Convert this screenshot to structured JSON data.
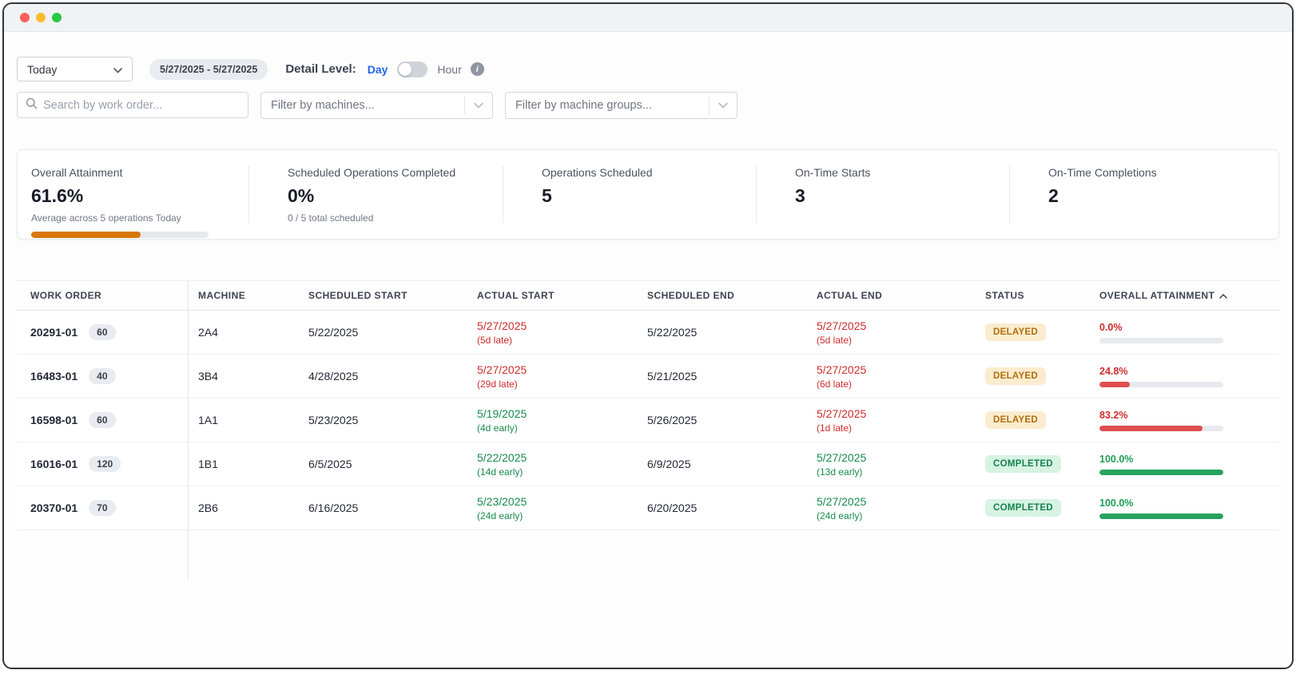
{
  "toolbar": {
    "period_select": {
      "value": "Today"
    },
    "date_range": "5/27/2025 - 5/27/2025",
    "detail_level": {
      "label": "Detail Level:",
      "day": "Day",
      "hour": "Hour",
      "info": "i"
    }
  },
  "filters": {
    "search_placeholder": "Search by work order...",
    "machines_placeholder": "Filter by machines...",
    "machine_groups_placeholder": "Filter by machine groups..."
  },
  "kpis": {
    "overall_attainment": {
      "label": "Overall Attainment",
      "value": "61.6%",
      "sub": "Average across 5 operations Today",
      "progress_pct": 61.6,
      "bar_color": "#d97706"
    },
    "scheduled_ops_completed": {
      "label": "Scheduled Operations Completed",
      "value": "0%",
      "sub": "0 / 5 total scheduled"
    },
    "operations_scheduled": {
      "label": "Operations Scheduled",
      "value": "5"
    },
    "on_time_starts": {
      "label": "On-Time Starts",
      "value": "3"
    },
    "on_time_completions": {
      "label": "On-Time Completions",
      "value": "2"
    }
  },
  "table": {
    "columns": [
      "WORK ORDER",
      "MACHINE",
      "SCHEDULED START",
      "ACTUAL START",
      "SCHEDULED END",
      "ACTUAL END",
      "STATUS",
      "OVERALL ATTAINMENT"
    ],
    "sort": {
      "column": "OVERALL ATTAINMENT",
      "direction": "ascending"
    },
    "rows": [
      {
        "work_order": "20291-01",
        "qty": "60",
        "machine": "2A4",
        "scheduled_start": "5/22/2025",
        "actual_start": {
          "date": "5/27/2025",
          "delta": "(5d late)",
          "tone": "late"
        },
        "scheduled_end": "5/22/2025",
        "actual_end": {
          "date": "5/27/2025",
          "delta": "(5d late)",
          "tone": "late"
        },
        "status": "DELAYED",
        "attainment": {
          "value": "0.0%",
          "pct": 0,
          "tone": "late"
        }
      },
      {
        "work_order": "16483-01",
        "qty": "40",
        "machine": "3B4",
        "scheduled_start": "4/28/2025",
        "actual_start": {
          "date": "5/27/2025",
          "delta": "(29d late)",
          "tone": "late"
        },
        "scheduled_end": "5/21/2025",
        "actual_end": {
          "date": "5/27/2025",
          "delta": "(6d late)",
          "tone": "late"
        },
        "status": "DELAYED",
        "attainment": {
          "value": "24.8%",
          "pct": 24.8,
          "tone": "late"
        }
      },
      {
        "work_order": "16598-01",
        "qty": "60",
        "machine": "1A1",
        "scheduled_start": "5/23/2025",
        "actual_start": {
          "date": "5/19/2025",
          "delta": "(4d early)",
          "tone": "early"
        },
        "scheduled_end": "5/26/2025",
        "actual_end": {
          "date": "5/27/2025",
          "delta": "(1d late)",
          "tone": "late"
        },
        "status": "DELAYED",
        "attainment": {
          "value": "83.2%",
          "pct": 83.2,
          "tone": "late"
        }
      },
      {
        "work_order": "16016-01",
        "qty": "120",
        "machine": "1B1",
        "scheduled_start": "6/5/2025",
        "actual_start": {
          "date": "5/22/2025",
          "delta": "(14d early)",
          "tone": "early"
        },
        "scheduled_end": "6/9/2025",
        "actual_end": {
          "date": "5/27/2025",
          "delta": "(13d early)",
          "tone": "early"
        },
        "status": "COMPLETED",
        "attainment": {
          "value": "100.0%",
          "pct": 100,
          "tone": "early"
        }
      },
      {
        "work_order": "20370-01",
        "qty": "70",
        "machine": "2B6",
        "scheduled_start": "6/16/2025",
        "actual_start": {
          "date": "5/23/2025",
          "delta": "(24d early)",
          "tone": "early"
        },
        "scheduled_end": "6/20/2025",
        "actual_end": {
          "date": "5/27/2025",
          "delta": "(24d early)",
          "tone": "early"
        },
        "status": "COMPLETED",
        "attainment": {
          "value": "100.0%",
          "pct": 100,
          "tone": "early"
        }
      }
    ]
  },
  "colors": {
    "late": "#ce2c2c",
    "early": "#178a4c",
    "delayed_badge_bg": "#fbeccf",
    "delayed_badge_text": "#b06e0a",
    "completed_badge_bg": "#d7f3e3",
    "completed_badge_text": "#17804d",
    "accent_blue": "#2563eb",
    "kpi_bar_orange": "#d97706"
  }
}
